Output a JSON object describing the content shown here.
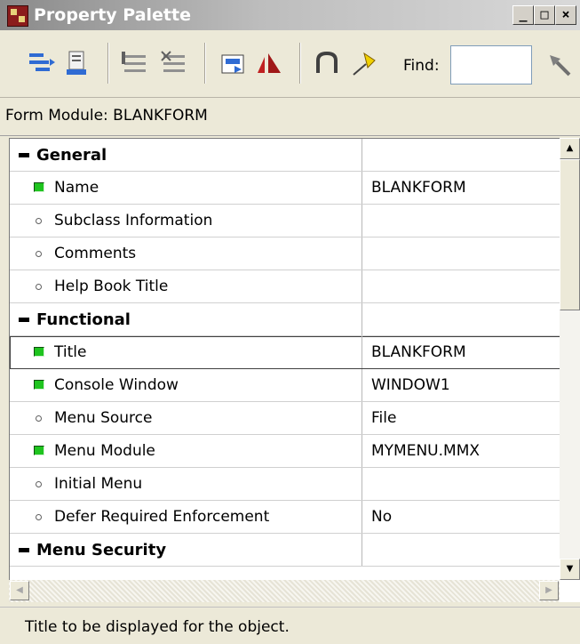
{
  "window": {
    "title": "Property Palette",
    "min_label": "_",
    "max_label": "□",
    "close_label": "×"
  },
  "toolbar": {
    "buttons": [
      {
        "name": "copy-properties-icon",
        "color": "#2f6bd3"
      },
      {
        "name": "paste-properties-icon",
        "color": "#2f6bd3"
      },
      {
        "name": "add-property-icon",
        "color": "#808080"
      },
      {
        "name": "delete-property-icon",
        "color": "#808080"
      },
      {
        "name": "property-class-icon",
        "color": "#2f6bd3"
      },
      {
        "name": "inherit-icon",
        "color": "#c02020"
      },
      {
        "name": "intersection-union-icon",
        "color": "#404040"
      },
      {
        "name": "freeze-pin-icon",
        "color": "#e8c000"
      }
    ],
    "find_label": "Find:",
    "find_value": "",
    "find_next_icon": "flashlight-search-icon"
  },
  "module": {
    "label": "Form Module: BLANKFORM"
  },
  "properties": [
    {
      "type": "category",
      "name": "General",
      "value": ""
    },
    {
      "type": "changed",
      "name": "Name",
      "value": "BLANKFORM"
    },
    {
      "type": "default",
      "name": "Subclass Information",
      "value": ""
    },
    {
      "type": "default",
      "name": "Comments",
      "value": ""
    },
    {
      "type": "default",
      "name": "Help Book Title",
      "value": ""
    },
    {
      "type": "category",
      "name": "Functional",
      "value": ""
    },
    {
      "type": "changed",
      "name": "Title",
      "value": "BLANKFORM",
      "selected": true
    },
    {
      "type": "changed",
      "name": "Console Window",
      "value": "WINDOW1"
    },
    {
      "type": "default",
      "name": "Menu Source",
      "value": "File"
    },
    {
      "type": "changed",
      "name": "Menu Module",
      "value": "MYMENU.MMX"
    },
    {
      "type": "default",
      "name": "Initial Menu",
      "value": ""
    },
    {
      "type": "default",
      "name": "Defer Required Enforcement",
      "value": "No"
    },
    {
      "type": "category",
      "name": "Menu Security",
      "value": ""
    }
  ],
  "colors": {
    "changed_bullet": "#1fc41f",
    "title_bar_start": "#8a8a8a",
    "chrome": "#ece9d8"
  },
  "status": {
    "text": "Title to be displayed for the object."
  }
}
